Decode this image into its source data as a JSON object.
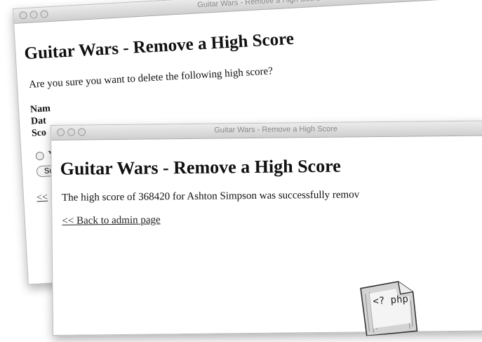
{
  "back_window": {
    "title": "Guitar Wars - Remove a High Score",
    "heading": "Guitar Wars - Remove a High Score",
    "question": "Are you sure you want to delete the following high score?",
    "field_labels": [
      "Nam",
      "Dat",
      "Sco"
    ],
    "radio_label": "Y",
    "submit_label": "Su",
    "link_text": "<<"
  },
  "front_window": {
    "title": "Guitar Wars - Remove a High Score",
    "heading": "Guitar Wars - Remove a High Score",
    "message": "The high score of 368420 for Ashton Simpson was successfully remov",
    "back_link": "<< Back to admin page"
  },
  "php_icon": {
    "text": "<? php"
  }
}
